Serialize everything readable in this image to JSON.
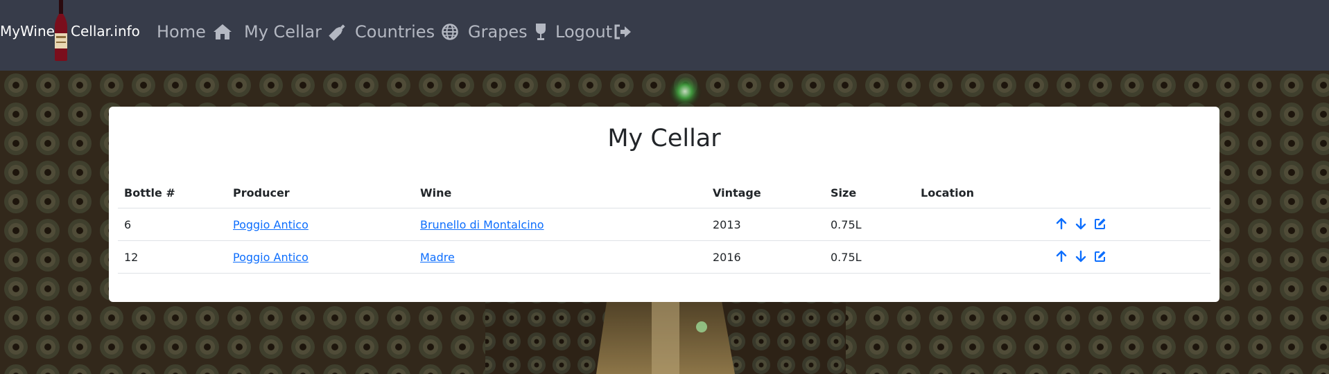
{
  "nav": {
    "brand_left": "MyWine",
    "brand_right": "Cellar.info",
    "items": [
      {
        "label": "Home",
        "icon": "home-icon"
      },
      {
        "label": "My Cellar",
        "icon": "bottle-icon"
      },
      {
        "label": "Countries",
        "icon": "globe-icon"
      },
      {
        "label": "Grapes",
        "icon": "wine-glass-icon"
      },
      {
        "label": "Logout",
        "icon": "logout-icon"
      }
    ]
  },
  "colors": {
    "navbar": "#373c4a",
    "nav_text": "#b4b8c2",
    "link": "#0d6efd",
    "card": "#ffffff"
  },
  "page": {
    "title": "My Cellar",
    "columns": [
      "Bottle #",
      "Producer",
      "Wine",
      "Vintage",
      "Size",
      "Location"
    ],
    "rows": [
      {
        "bottle": "6",
        "producer": "Poggio Antico",
        "wine": "Brunello di Montalcino",
        "vintage": "2013",
        "size": "0.75L",
        "location": ""
      },
      {
        "bottle": "12",
        "producer": "Poggio Antico",
        "wine": "Madre",
        "vintage": "2016",
        "size": "0.75L",
        "location": ""
      }
    ],
    "row_actions": [
      "arrow-up-icon",
      "arrow-down-icon",
      "edit-icon"
    ]
  }
}
